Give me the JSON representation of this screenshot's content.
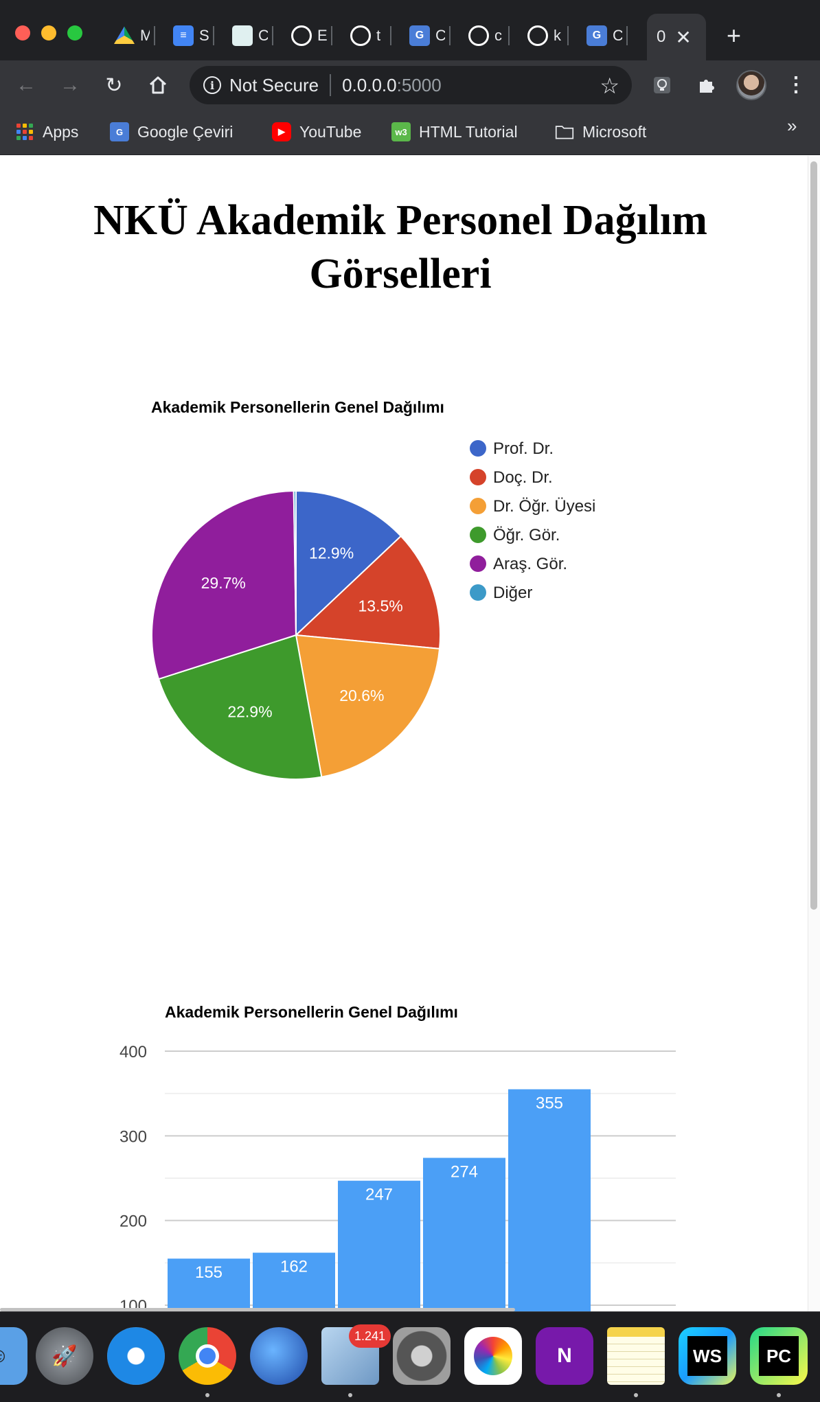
{
  "browser": {
    "tabs": [
      {
        "title": "M",
        "icon": "google-drive-icon",
        "color": "#1fa463"
      },
      {
        "title": "S",
        "icon": "google-docs-icon",
        "color": "#4285f4"
      },
      {
        "title": "C",
        "icon": "page-thumbnail-icon",
        "color": "#e0f0f0"
      },
      {
        "title": "E",
        "icon": "github-icon",
        "color": "#ffffff"
      },
      {
        "title": "t",
        "icon": "github-icon",
        "color": "#ffffff"
      },
      {
        "title": "C",
        "icon": "google-translate-icon",
        "color": "#4a7dd7"
      },
      {
        "title": "c",
        "icon": "github-icon",
        "color": "#ffffff"
      },
      {
        "title": "k",
        "icon": "github-icon",
        "color": "#ffffff"
      },
      {
        "title": "C",
        "icon": "google-translate-icon",
        "color": "#4a7dd7"
      }
    ],
    "active_tab": {
      "title": "0"
    },
    "security_label": "Not Secure",
    "url_host": "0.0.0.0",
    "url_port": ":5000",
    "bookmarks": [
      {
        "label": "Apps",
        "icon": "apps-grid-icon"
      },
      {
        "label": "Google Çeviri",
        "icon": "google-translate-icon"
      },
      {
        "label": "YouTube",
        "icon": "youtube-icon"
      },
      {
        "label": "HTML Tutorial",
        "icon": "w3schools-icon"
      },
      {
        "label": "Microsoft",
        "icon": "folder-icon"
      }
    ],
    "bookmarks_overflow": "»"
  },
  "page": {
    "title": "NKÜ Akademik Personel Dağılım Görselleri"
  },
  "chart_data": [
    {
      "type": "pie",
      "title": "Akademik Personellerin Genel Dağılımı",
      "legend_position": "right",
      "categories": [
        "Prof. Dr.",
        "Doç. Dr.",
        "Dr. Öğr. Üyesi",
        "Öğr. Gör.",
        "Araş. Gör.",
        "Diğer"
      ],
      "values": [
        155,
        162,
        247,
        274,
        355,
        3
      ],
      "percent_labels": [
        "12.9%",
        "13.5%",
        "20.6%",
        "22.9%",
        "29.7%",
        ""
      ],
      "colors": [
        "#3c66c9",
        "#d5432a",
        "#f49f36",
        "#3e9a2c",
        "#901e9c",
        "#3c9ac8"
      ]
    },
    {
      "type": "bar",
      "title": "Akademik Personellerin Genel Dağılımı",
      "values": [
        155,
        162,
        247,
        274,
        355
      ],
      "data_labels": [
        "155",
        "162",
        "247",
        "274",
        "355"
      ],
      "y_ticks": [
        "400",
        "300",
        "200",
        "100"
      ],
      "ylim": [
        100,
        400
      ],
      "grid": true,
      "color": "#4b9ff6"
    }
  ],
  "dock": {
    "apps": [
      "finder-icon",
      "launchpad-icon",
      "safari-icon",
      "chrome-icon",
      "firefox-icon",
      "mail-icon",
      "system-preferences-icon",
      "photos-icon",
      "onenote-icon",
      "notes-icon",
      "webstorm-icon",
      "pycharm-icon"
    ],
    "mail_badge": "1.241",
    "ws_label": "WS",
    "pc_label": "PC",
    "onenote_label": "N"
  }
}
